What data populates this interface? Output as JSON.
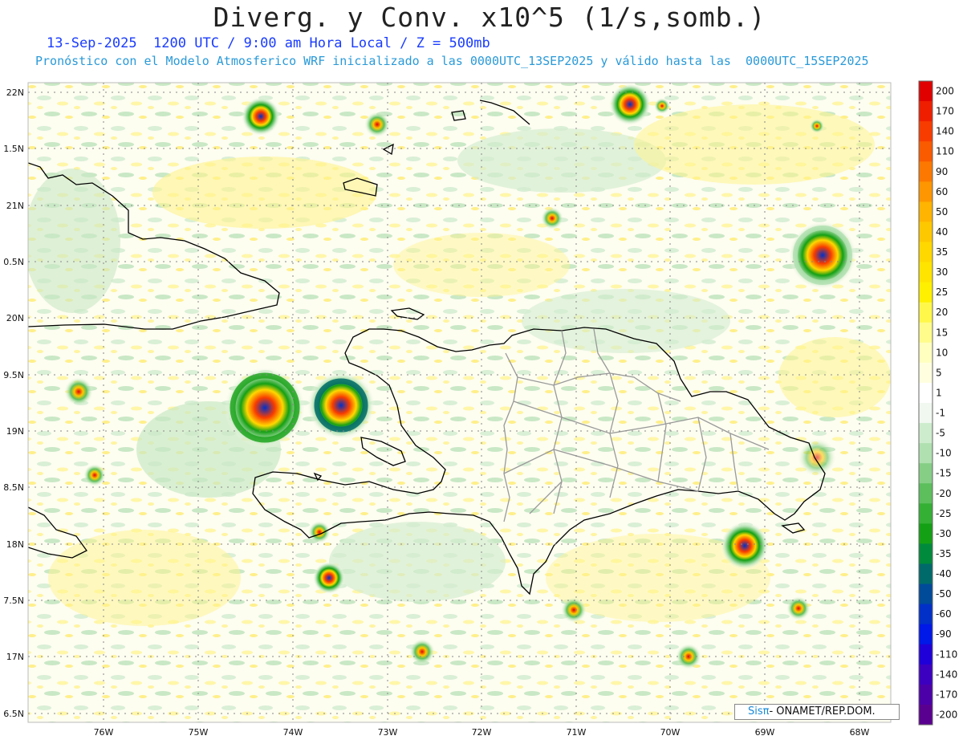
{
  "header": {
    "title": "Diverg. y Conv. x10^5 (1/s,somb.)",
    "subtitle_line1": "13-Sep-2025  1200 UTC / 9:00 am Hora Local / Z = 500mb",
    "subtitle_line2": "Pronóstico con el Modelo Atmosferico WRF inicializado a las 0000UTC_13SEP2025 y válido hasta las  0000UTC_15SEP2025"
  },
  "map": {
    "lon_range": [
      -76.65,
      -67.65
    ],
    "lat_range": [
      16.45,
      22.1
    ],
    "lat_ticks": [
      "22N",
      "1.5N",
      "21N",
      "0.5N",
      "20N",
      "9.5N",
      "19N",
      "8.5N",
      "18N",
      "7.5N",
      "17N",
      "6.5N"
    ],
    "lon_ticks": [
      "76W",
      "75W",
      "74W",
      "73W",
      "72W",
      "71W",
      "70W",
      "69W",
      "68W"
    ],
    "field_colors": {
      "ocean_bg": "#fdfdf0",
      "convergence": "#8ed08e",
      "divergence": "#fff07a"
    }
  },
  "legend": {
    "labels": [
      "200",
      "170",
      "140",
      "110",
      "90",
      "60",
      "50",
      "40",
      "35",
      "30",
      "25",
      "20",
      "15",
      "10",
      "5",
      "1",
      "-1",
      "-5",
      "-10",
      "-15",
      "-20",
      "-25",
      "-30",
      "-35",
      "-40",
      "-50",
      "-60",
      "-90",
      "-110",
      "-140",
      "-170",
      "-200"
    ],
    "colors": [
      "#e00000",
      "#f01e00",
      "#f83c00",
      "#fa5a00",
      "#fc7800",
      "#fd9600",
      "#feb400",
      "#fec800",
      "#ffd800",
      "#ffe400",
      "#fff000",
      "#fff84a",
      "#fffc8c",
      "#ffffc0",
      "#ffffe0",
      "#ffffff",
      "#f0f8f0",
      "#cdeccd",
      "#b0e0b0",
      "#86ce86",
      "#5cbf5c",
      "#34b034",
      "#14a014",
      "#008a3c",
      "#006a6a",
      "#004a9a",
      "#0030c8",
      "#0018e8",
      "#2000d8",
      "#3c00c0",
      "#4c00a8",
      "#5a0090"
    ]
  },
  "credit": {
    "sis": "Sisπ",
    "rest": "- ONAMET/REP.DOM."
  }
}
